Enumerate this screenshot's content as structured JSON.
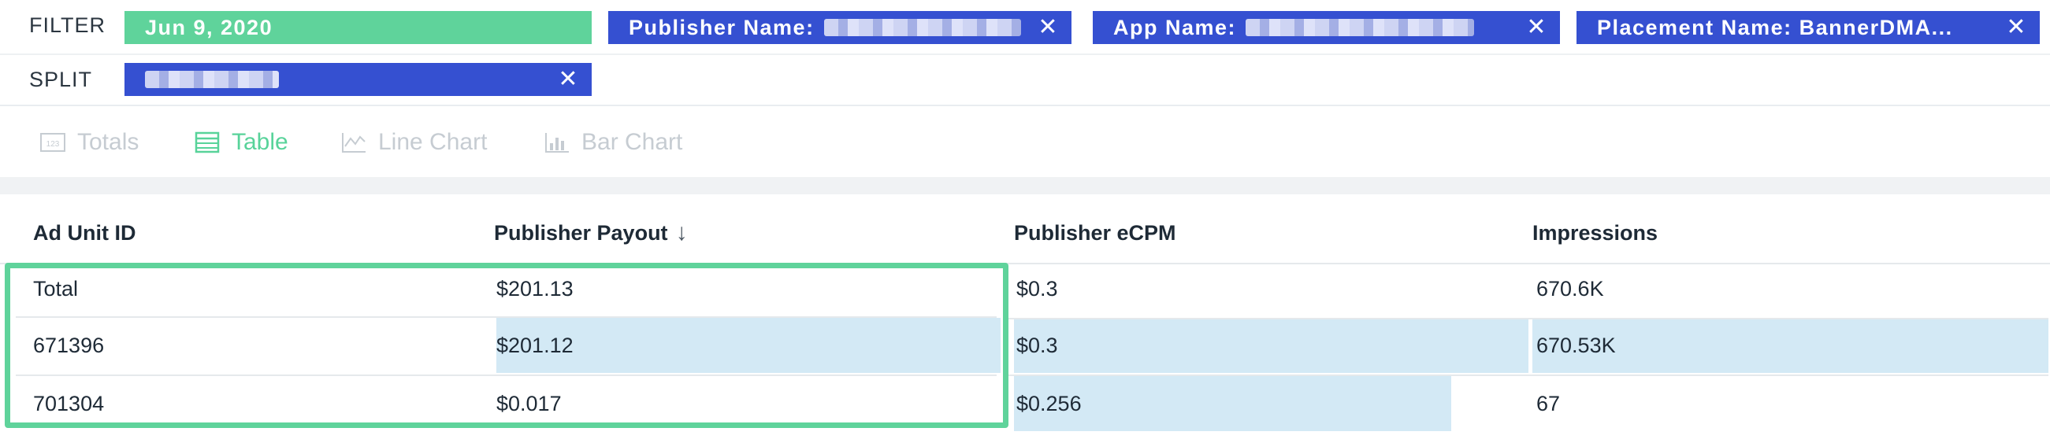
{
  "query": {
    "filter_label": "FILTER",
    "split_label": "SPLIT",
    "filters": [
      {
        "label": "Jun 9, 2020",
        "color": "#5fd39b",
        "removable": false
      },
      {
        "label": "Publisher Name:",
        "color": "#3550d1",
        "removable": true
      },
      {
        "label": "App Name:",
        "color": "#3550d1",
        "removable": true
      },
      {
        "label": "Placement Name: BannerDMA...",
        "color": "#3550d1",
        "removable": true
      }
    ],
    "splits": [
      {
        "label": "",
        "color": "#3550d1",
        "removable": true
      }
    ],
    "remove_icon": "close-icon"
  },
  "views": {
    "active": "Table",
    "tabs": [
      {
        "label": "Totals",
        "icon": "totals-icon"
      },
      {
        "label": "Table",
        "icon": "table-icon"
      },
      {
        "label": "Line Chart",
        "icon": "line-chart-icon"
      },
      {
        "label": "Bar Chart",
        "icon": "bar-chart-icon"
      }
    ]
  },
  "table": {
    "columns": [
      "Ad Unit ID",
      "Publisher Payout",
      "Publisher eCPM",
      "Impressions"
    ],
    "sort_column": "Publisher Payout",
    "sort_icon": "sort-descending-arrow-icon",
    "rows": [
      {
        "id": "Total",
        "payout": "$201.13",
        "ecpm": "$0.3",
        "impressions": "670.6K"
      },
      {
        "id": "671396",
        "payout": "$201.12",
        "ecpm": "$0.3",
        "impressions": "670.53K",
        "payout_share": 1.0,
        "ecpm_share": 1.0,
        "impressions_share": 1.0
      },
      {
        "id": "701304",
        "payout": "$0.017",
        "ecpm": "$0.256",
        "impressions": "67",
        "payout_share": 0.0,
        "ecpm_share": 0.85,
        "impressions_share": 0.0
      }
    ],
    "bar_color": "#d3e9f5",
    "highlight_color": "#5fd39b"
  }
}
